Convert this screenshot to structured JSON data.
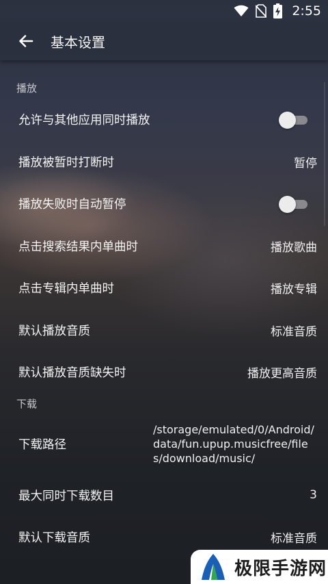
{
  "status_bar": {
    "time": "2:55",
    "icons": [
      "wifi-icon",
      "no-sim-icon",
      "battery-charging-icon"
    ]
  },
  "header": {
    "title": "基本设置",
    "back_icon": "arrow-left-icon"
  },
  "sections": {
    "playback": {
      "title": "播放",
      "rows": [
        {
          "label": "允许与其他应用同时播放",
          "type": "toggle",
          "on": false
        },
        {
          "label": "播放被暂时打断时",
          "value": "暂停"
        },
        {
          "label": "播放失败时自动暂停",
          "type": "toggle",
          "on": false
        },
        {
          "label": "点击搜索结果内单曲时",
          "value": "播放歌曲"
        },
        {
          "label": "点击专辑内单曲时",
          "value": "播放专辑"
        },
        {
          "label": "默认播放音质",
          "value": "标准音质"
        },
        {
          "label": "默认播放音质缺失时",
          "value": "播放更高音质"
        }
      ]
    },
    "download": {
      "title": "下载",
      "rows": [
        {
          "label": "下载路径",
          "value": "/storage/emulated/0/Android/data/fun.upup.musicfree/files/download/music/"
        },
        {
          "label": "最大同时下载数目",
          "value": "3"
        },
        {
          "label": "默认下载音质",
          "value": "标准音质"
        }
      ]
    }
  },
  "watermark": {
    "text": "极限手游网"
  },
  "colors": {
    "toggle_track": "#8a8a8e",
    "toggle_thumb": "#ececec",
    "watermark_blue": "#1a5fb4",
    "watermark_green": "#2fa84f"
  }
}
